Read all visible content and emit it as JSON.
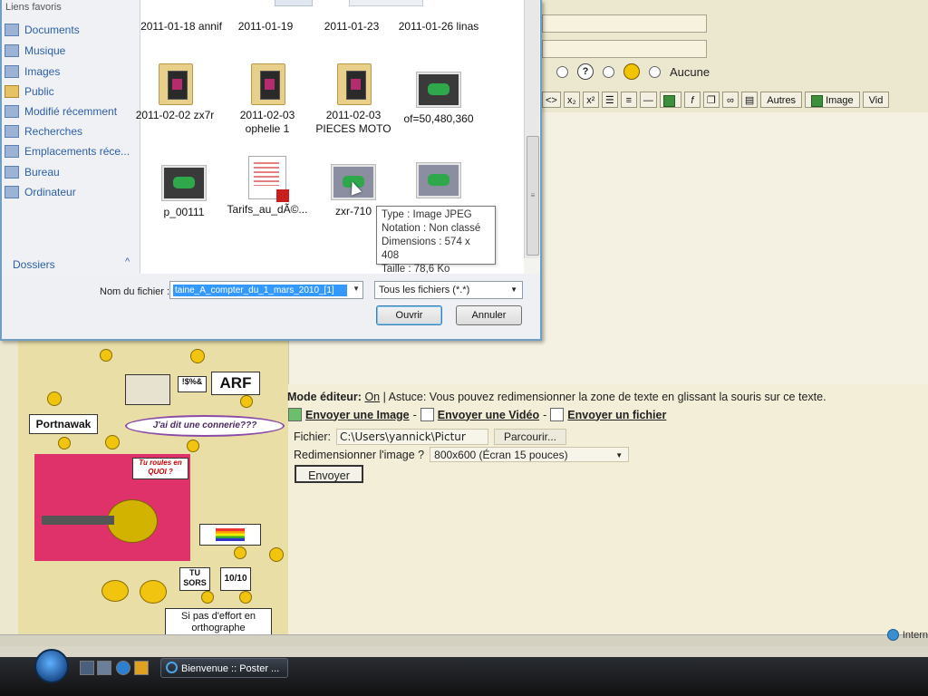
{
  "dialog": {
    "nav_header": "Liens favoris",
    "nav_items": [
      {
        "label": "Documents",
        "icon": "documents-icon"
      },
      {
        "label": "Musique",
        "icon": "music-icon"
      },
      {
        "label": "Images",
        "icon": "images-icon"
      },
      {
        "label": "Public",
        "icon": "folder-icon"
      },
      {
        "label": "Modifié récemment",
        "icon": "recent-icon"
      },
      {
        "label": "Recherches",
        "icon": "search-icon"
      },
      {
        "label": "Emplacements réce...",
        "icon": "places-icon"
      },
      {
        "label": "Bureau",
        "icon": "desktop-icon"
      },
      {
        "label": "Ordinateur",
        "icon": "computer-icon"
      }
    ],
    "nav_footer": "Dossiers",
    "nav_chevron": "^",
    "files": [
      {
        "name": "2011-01-18 annif",
        "kind": "folder"
      },
      {
        "name": "2011-01-19",
        "kind": "folder"
      },
      {
        "name": "2011-01-23",
        "kind": "folder"
      },
      {
        "name": "2011-01-26 linas",
        "kind": "folder"
      },
      {
        "name": "2011-02-02 zx7r",
        "kind": "folder"
      },
      {
        "name": "2011-02-03 ophelie 1",
        "kind": "folder"
      },
      {
        "name": "2011-02-03 PIECES MOTO",
        "kind": "folder"
      },
      {
        "name": "of=50,480,360",
        "kind": "image"
      },
      {
        "name": "p_00111",
        "kind": "image"
      },
      {
        "name": "Tarifs_au_dÃ©...",
        "kind": "pdf"
      },
      {
        "name": "zxr-710",
        "kind": "image"
      },
      {
        "name": "",
        "kind": "image"
      }
    ],
    "tooltip": {
      "type": "Type : Image JPEG",
      "rating": "Notation : Non classé",
      "dimensions": "Dimensions : 574 x 408",
      "size": "Taille : 78,6 Ko"
    },
    "filename_label": "Nom du fichier :",
    "filename_value": "taine_A_compter_du_1_mars_2010_[1]",
    "filetype_value": "Tous les fichiers (*.*)",
    "open_label": "Ouvrir",
    "cancel_label": "Annuler"
  },
  "editor": {
    "radio_none_label": "Aucune",
    "toolbar": {
      "x2_sub": "x₂",
      "x2_sup": "x²",
      "autres_label": "Autres",
      "image_label": "Image",
      "video_label": "Vid"
    },
    "mode_label": "Mode éditeur:",
    "mode_value": "On",
    "astuce": "| Astuce: Vous pouvez redimensionner la zone de texte en glissant la souris sur ce texte.",
    "send_image": "Envoyer une Image",
    "send_video": "Envoyer une Vidéo",
    "send_file": "Envoyer un fichier",
    "separator": "-",
    "file_label": "Fichier:",
    "file_value": "C:\\Users\\yannick\\Pictur",
    "browse_label": "Parcourir...",
    "resize_label": "Redimensionner l'image ?",
    "resize_value": "800x600 (Écran 15 pouces)",
    "submit_label": "Envoyer"
  },
  "left_panel": {
    "sign_arf": "ARF",
    "sign_portnawak": "Portnawak",
    "bubble": "J'ai dit une connerie???",
    "sign_tusors": "TU SORS",
    "sign_score": "10/10",
    "sign_effort": "Si pas d'effort en orthographe",
    "card_text": "Tu roules en QUOI ?"
  },
  "status": {
    "zone": "Intern"
  },
  "taskbar": {
    "task_label": "Bienvenue :: Poster ..."
  }
}
